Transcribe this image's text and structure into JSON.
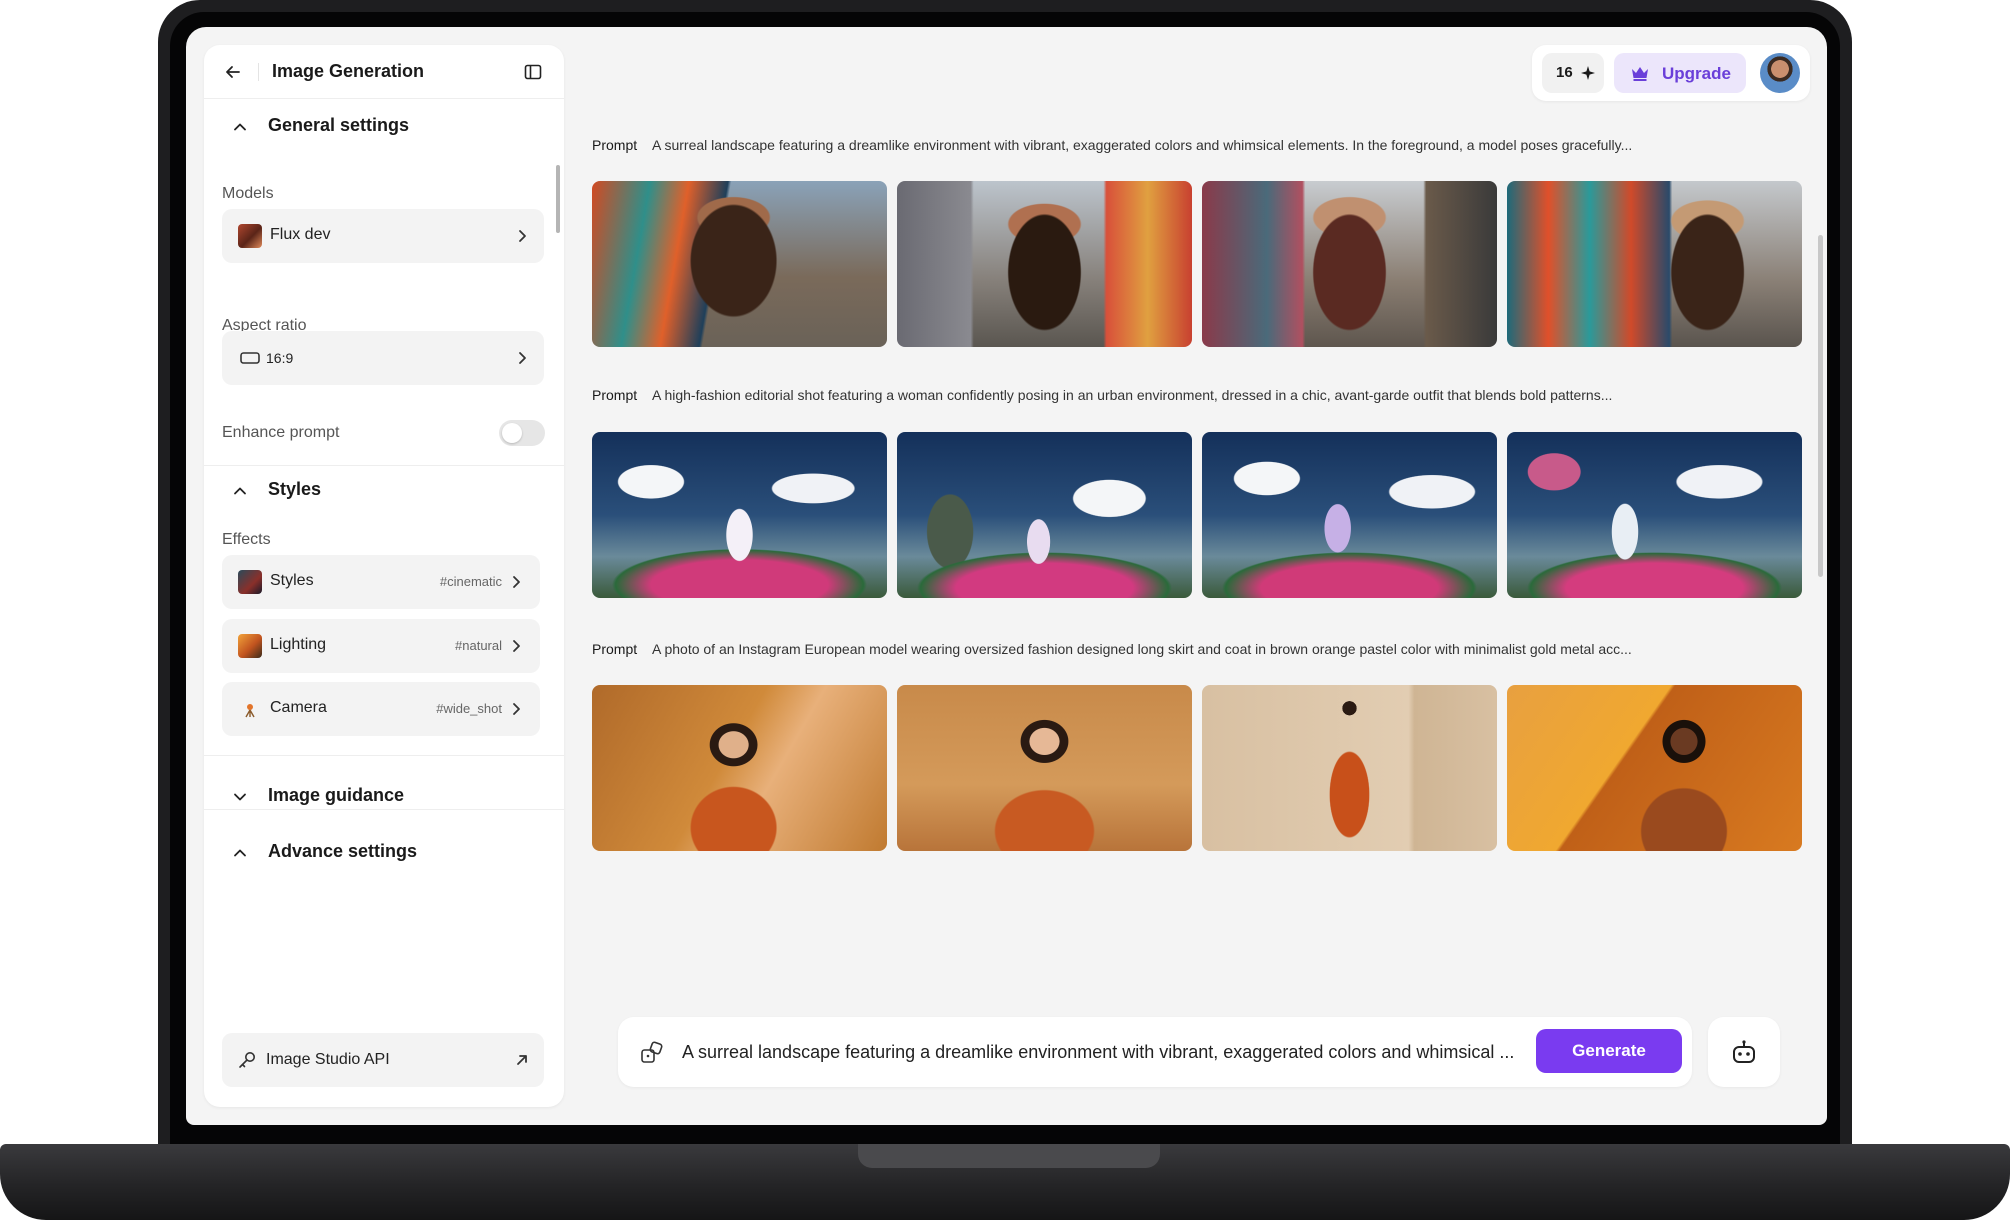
{
  "sidebar": {
    "title": "Image Generation",
    "general_settings": "General settings",
    "models_label": "Models",
    "model_value": "Flux dev",
    "aspect_ratio_label": "Aspect ratio",
    "aspect_ratio_value": "16:9",
    "enhance_prompt_label": "Enhance prompt",
    "enhance_prompt_on": false,
    "styles_section": "Styles",
    "effects_label": "Effects",
    "effects": [
      {
        "label": "Styles",
        "tag": "#cinematic"
      },
      {
        "label": "Lighting",
        "tag": "#natural"
      },
      {
        "label": "Camera",
        "tag": "#wide_shot"
      }
    ],
    "image_guidance": "Image guidance",
    "advance_settings": "Advance settings",
    "api_button": "Image Studio API"
  },
  "topbar": {
    "credits": "16",
    "upgrade_label": "Upgrade"
  },
  "results": [
    {
      "label": "Prompt",
      "text": "A surreal landscape featuring a dreamlike environment with vibrant, exaggerated colors and whimsical elements. In the foreground, a model poses gracefully..."
    },
    {
      "label": "Prompt",
      "text": "A high-fashion editorial shot featuring a woman confidently posing in an urban environment, dressed in a chic, avant-garde outfit that blends bold patterns..."
    },
    {
      "label": "Prompt",
      "text": "A photo of an Instagram European model wearing oversized fashion designed long skirt and coat in brown orange pastel color with minimalist gold metal acc..."
    }
  ],
  "input": {
    "prompt_text": "A surreal landscape featuring a dreamlike environment with vibrant, exaggerated colors and whimsical ...",
    "generate_label": "Generate"
  },
  "colors": {
    "accent": "#7a3bf0",
    "upgrade_bg": "#ece6fb",
    "upgrade_text": "#6a3fd9"
  }
}
